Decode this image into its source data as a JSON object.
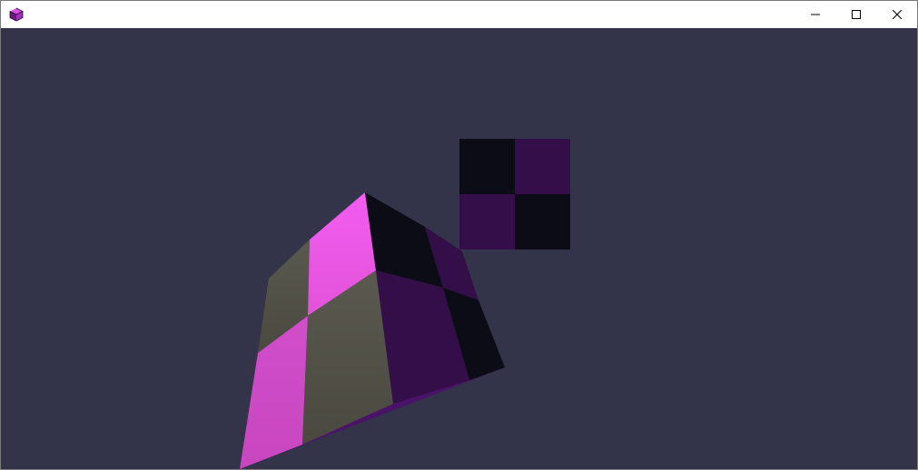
{
  "window": {
    "title": "",
    "icon": "purple-cube-icon",
    "controls": {
      "minimize_icon": "minimize-icon",
      "maximize_icon": "maximize-icon",
      "close_icon": "close-icon"
    }
  },
  "scene": {
    "background_color": "#33334a",
    "objects": [
      {
        "kind": "textured-cube",
        "colors": {
          "pink": "#f35cf0",
          "pink_shaded": "#cf4bc8",
          "gray": "#54534a",
          "dark": "#0c0c16",
          "purple": "#330e48"
        }
      },
      {
        "kind": "checkerboard-texture-quad",
        "colors": {
          "dark": "#0c0c16",
          "purple": "#330e48"
        }
      }
    ]
  }
}
